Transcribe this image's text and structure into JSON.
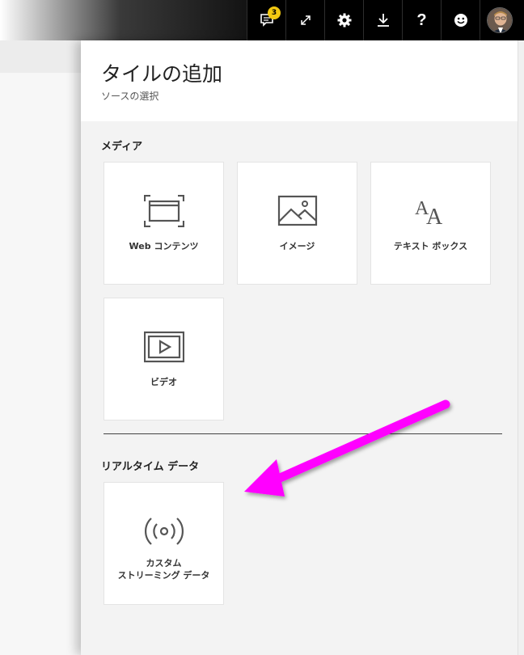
{
  "toolbar": {
    "notification_count": "3",
    "help_label": "?",
    "icons": [
      "notifications-icon",
      "fullscreen-icon",
      "gear-icon",
      "download-icon",
      "help-icon",
      "smiley-icon",
      "avatar"
    ]
  },
  "panel": {
    "title": "タイルの追加",
    "subtitle": "ソースの選択"
  },
  "sections": {
    "media": {
      "label": "メディア",
      "tiles": [
        {
          "label": "Web コンテンツ",
          "icon": "web-content-icon"
        },
        {
          "label": "イメージ",
          "icon": "image-icon"
        },
        {
          "label": "テキスト ボックス",
          "icon": "text-box-icon"
        },
        {
          "label": "ビデオ",
          "icon": "video-icon"
        }
      ]
    },
    "realtime": {
      "label": "リアルタイム データ",
      "tiles": [
        {
          "label_line1": "カスタム",
          "label_line2": "ストリーミング データ",
          "icon": "streaming-icon"
        }
      ]
    }
  },
  "colors": {
    "toolbar_bg": "#000000",
    "badge": "#f2c811",
    "panel_bg": "#f3f3f3",
    "tile_bg": "#ffffff",
    "annotation_arrow": "#ff00ff"
  }
}
